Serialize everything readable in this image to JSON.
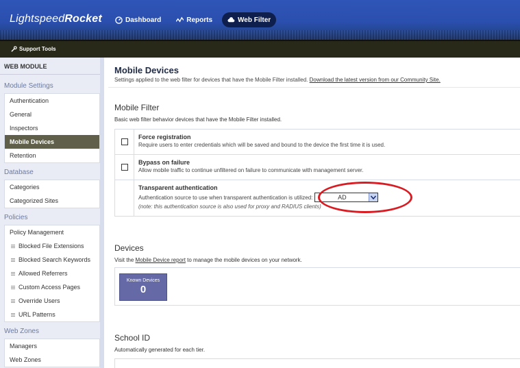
{
  "app": {
    "logo_part1": "Lightspeed",
    "logo_part2": "Rocket"
  },
  "nav": [
    {
      "label": "Dashboard",
      "icon": "dashboard-icon"
    },
    {
      "label": "Reports",
      "icon": "reports-icon"
    },
    {
      "label": "Web Filter",
      "icon": "cloud-icon",
      "active": true
    }
  ],
  "tools": {
    "label": "Support Tools",
    "icon": "wrench-icon"
  },
  "sidebar": {
    "module": "WEB MODULE",
    "sections": [
      {
        "title": "Module Settings",
        "items": [
          "Authentication",
          "General",
          "Inspectors",
          "Mobile Devices",
          "Retention"
        ]
      },
      {
        "title": "Database",
        "items": [
          "Categories",
          "Categorized Sites"
        ]
      },
      {
        "title": "Policies",
        "items": [
          "Policy Management",
          "Blocked File Extensions",
          "Blocked Search Keywords",
          "Allowed Referrers",
          "Custom Access Pages",
          "Override Users",
          "URL Patterns"
        ]
      },
      {
        "title": "Web Zones",
        "items": [
          "Managers",
          "Web Zones"
        ]
      }
    ],
    "active_item": "Mobile Devices"
  },
  "page": {
    "title": "Mobile Devices",
    "desc": "Settings applied to the web filter for devices that have the Mobile Filter installed.",
    "desc_link": "Download the latest version from our Community Site."
  },
  "mobile_filter": {
    "heading": "Mobile Filter",
    "desc": "Basic web filter behavior devices that have the Mobile Filter installed.",
    "force": {
      "title": "Force registration",
      "desc": "Require users to enter credentials which will be saved and bound to the device the first time it is used.",
      "checked": false
    },
    "bypass": {
      "title": "Bypass on failure",
      "desc": "Allow mobile traffic to continue unfiltered on failure to communicate with management server.",
      "checked": false
    },
    "transparent": {
      "title": "Transparent authentication",
      "desc": "Authentication source to use when transparent authentication is utilized:",
      "value": "AD",
      "note": "(note: this authentication source is also used for proxy and RADIUS clients)"
    },
    "highlight_color": "#d71d23"
  },
  "devices": {
    "heading": "Devices",
    "desc_pre": "Visit the",
    "desc_link": "Mobile Device report",
    "desc_post": "to manage the mobile devices on your network.",
    "tile_label": "Known Devices",
    "tile_value": "0"
  },
  "school": {
    "heading": "School ID",
    "desc": "Automatically generated for each tier."
  }
}
